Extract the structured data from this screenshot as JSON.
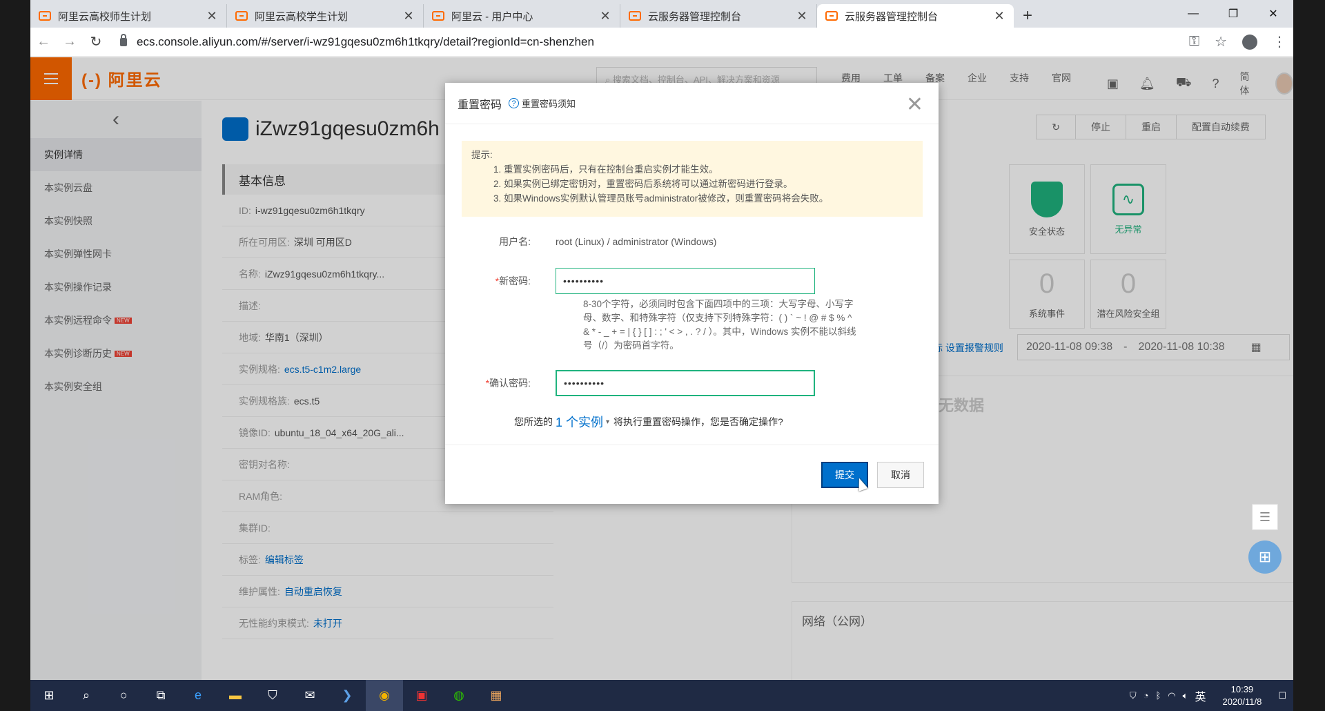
{
  "browser": {
    "tabs": [
      {
        "title": "阿里云高校师生计划",
        "active": false
      },
      {
        "title": "阿里云高校学生计划",
        "active": false
      },
      {
        "title": "阿里云 - 用户中心",
        "active": false
      },
      {
        "title": "云服务器管理控制台",
        "active": false
      },
      {
        "title": "云服务器管理控制台",
        "active": true
      }
    ],
    "url": "ecs.console.aliyun.com/#/server/i-wz91gqesu0zm6h1tkqry/detail?regionId=cn-shenzhen"
  },
  "header": {
    "logo": "(-) 阿里云",
    "search_placeholder": "搜索文档、控制台、API、解决方案和资源",
    "links": [
      "费用",
      "工单",
      "备案",
      "企业",
      "支持",
      "官网"
    ],
    "lang": "简体"
  },
  "sidebar": {
    "items": [
      {
        "label": "实例详情",
        "active": true,
        "new": false
      },
      {
        "label": "本实例云盘",
        "active": false,
        "new": false
      },
      {
        "label": "本实例快照",
        "active": false,
        "new": false
      },
      {
        "label": "本实例弹性网卡",
        "active": false,
        "new": false
      },
      {
        "label": "本实例操作记录",
        "active": false,
        "new": false
      },
      {
        "label": "本实例远程命令",
        "active": false,
        "new": true
      },
      {
        "label": "本实例诊断历史",
        "active": false,
        "new": true
      },
      {
        "label": "本实例安全组",
        "active": false,
        "new": false
      }
    ],
    "new_badge": "NEW"
  },
  "main": {
    "instance_title": "iZwz91gqesu0zm6h",
    "top_buttons": [
      "停止",
      "重启",
      "配置自动续费"
    ],
    "basic_info_title": "基本信息",
    "basic_info": [
      {
        "k": "ID:",
        "v": "i-wz91gqesu0zm6h1tkqry",
        "link": false
      },
      {
        "k": "所在可用区:",
        "v": "深圳 可用区D",
        "link": false
      },
      {
        "k": "名称:",
        "v": "iZwz91gqesu0zm6h1tkqry...",
        "link": false
      },
      {
        "k": "描述:",
        "v": "",
        "link": false
      },
      {
        "k": "地域:",
        "v": "华南1（深圳）",
        "link": false
      },
      {
        "k": "实例规格:",
        "v": "ecs.t5-c1m2.large",
        "link": true
      },
      {
        "k": "实例规格族:",
        "v": "ecs.t5",
        "link": false
      },
      {
        "k": "镜像ID:",
        "v": "ubuntu_18_04_x64_20G_ali...",
        "link": false
      },
      {
        "k": "密钥对名称:",
        "v": "",
        "link": false
      },
      {
        "k": "RAM角色:",
        "v": "",
        "link": false
      },
      {
        "k": "集群ID:",
        "v": "",
        "link": false
      },
      {
        "k": "标签:",
        "v": "编辑标签",
        "link": true
      },
      {
        "k": "维护属性:",
        "v": "自动重启恢复",
        "link": true
      },
      {
        "k": "无性能约束模式:",
        "v": "未打开",
        "link": true
      }
    ],
    "status": {
      "security_label": "安全状态",
      "health_label": "无异常",
      "events_count": "0",
      "events_label": "系统事件",
      "risk_count": "0",
      "risk_label": "潜在风险安全组"
    },
    "alarm_link": "标 设置报警规则",
    "date_from": "2020-11-08 09:38",
    "date_sep": "-",
    "date_to": "2020-11-08 10:38",
    "no_data": "无数据",
    "network_title": "网络（公网）"
  },
  "modal": {
    "title": "重置密码",
    "help_link": "重置密码须知",
    "tip_title": "提示:",
    "tips": [
      "1. 重置实例密码后，只有在控制台重启实例才能生效。",
      "2. 如果实例已绑定密钥对，重置密码后系统将可以通过新密码进行登录。",
      "3. 如果Windows实例默认管理员账号administrator被修改，则重置密码将会失败。"
    ],
    "username_label": "用户名:",
    "username_value": "root (Linux) / administrator (Windows)",
    "new_pw_label": "新密码:",
    "new_pw_value": "••••••••••",
    "hint": "8-30个字符，必须同时包含下面四项中的三项：大写字母、小写字母、数字、和特殊字符（仅支持下列特殊字符：( ) ` ~ ! @ # $ % ^ & * - _ + = | { } [ ] : ; ' < > , . ? / ）。其中，Windows 实例不能以斜线号（/）为密码首字符。",
    "confirm_pw_label": "确认密码:",
    "confirm_pw_value": "••••••••••",
    "confirm_prefix": "您所选的",
    "confirm_count": "1 个实例",
    "confirm_suffix": "将执行重置密码操作，您是否确定操作?",
    "submit": "提交",
    "cancel": "取消"
  },
  "taskbar": {
    "time": "10:39",
    "date": "2020/11/8",
    "ime": "英"
  }
}
